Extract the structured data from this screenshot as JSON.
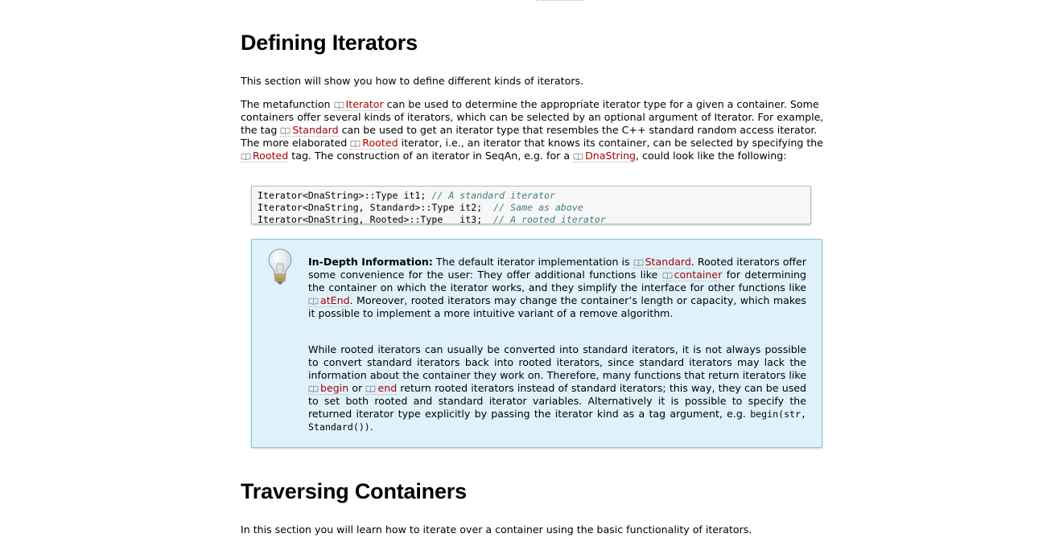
{
  "section1": {
    "title": "Defining Iterators",
    "intro": "This section will show you how to define different kinds of iterators.",
    "meta": {
      "t1": "The metafunction ",
      "ref_iterator": "Iterator",
      "t2": " can be used to determine the appropriate iterator type for a given a container. Some containers offer several kinds of iterators, which can be selected by an optional argument of Iterator. For example, the tag ",
      "ref_standard": "Standard",
      "t3": " can be used to get an iterator type that resembles the C++ standard random access iterator. The more elaborated ",
      "ref_rooted": "Rooted",
      "t4": " iterator, i.e., an iterator that knows its container, can be selected by specifying the ",
      "ref_rooted2": "Rooted",
      "t5": " tag. The construction of an iterator in SeqAn, e.g. for a ",
      "ref_dnastring": "DnaString",
      "t6": ", could look like the following:"
    },
    "code": [
      {
        "code": "Iterator<DnaString>::Type it1; ",
        "comment": "// A standard iterator"
      },
      {
        "code": "Iterator<DnaString, Standard>::Type it2;  ",
        "comment": "// Same as above"
      },
      {
        "code": "Iterator<DnaString, Rooted>::Type   it3;  ",
        "comment": "// A rooted iterator"
      }
    ],
    "info": {
      "icon": "lightbulb-icon",
      "heading": "In-Depth Information:",
      "p1": {
        "t1": " The default iterator implementation is ",
        "ref_standard": "Standard",
        "t2": ". Rooted iterators offer some convenience for the user: They offer additional functions like ",
        "ref_container": "container",
        "t3": " for determining the container on which the iterator works, and they simplify the interface for other functions like ",
        "ref_atend": "atEnd",
        "t4": ". Moreover, rooted iterators may change the container’s length or capacity, which makes it possible to implement a more intuitive variant of a remove algorithm."
      },
      "p2": {
        "t1": "While rooted iterators can usually be converted into standard iterators, it is not always possible to convert standard iterators back into rooted iterators, since standard iterators may lack the information about the container they work on. Therefore, many functions that return iterators like ",
        "ref_begin": "begin",
        "t2": " or ",
        "ref_end": "end",
        "t3": " return rooted iterators instead of standard iterators; this way, they can be used to set both rooted and standard iterator variables. Alternatively it is possible to specify the returned iterator type explicitly by passing the iterator kind as a tag argument, e.g. ",
        "code": "begin(str, Standard())",
        "t4": "."
      }
    }
  },
  "section2": {
    "title": "Traversing Containers",
    "intro": "In this section you will learn how to iterate over a container using the basic functionality of iterators."
  },
  "colors": {
    "link": "#aa0000",
    "info_bg": "#dff2fb",
    "info_border": "#8fc3db",
    "comment": "#408080"
  }
}
